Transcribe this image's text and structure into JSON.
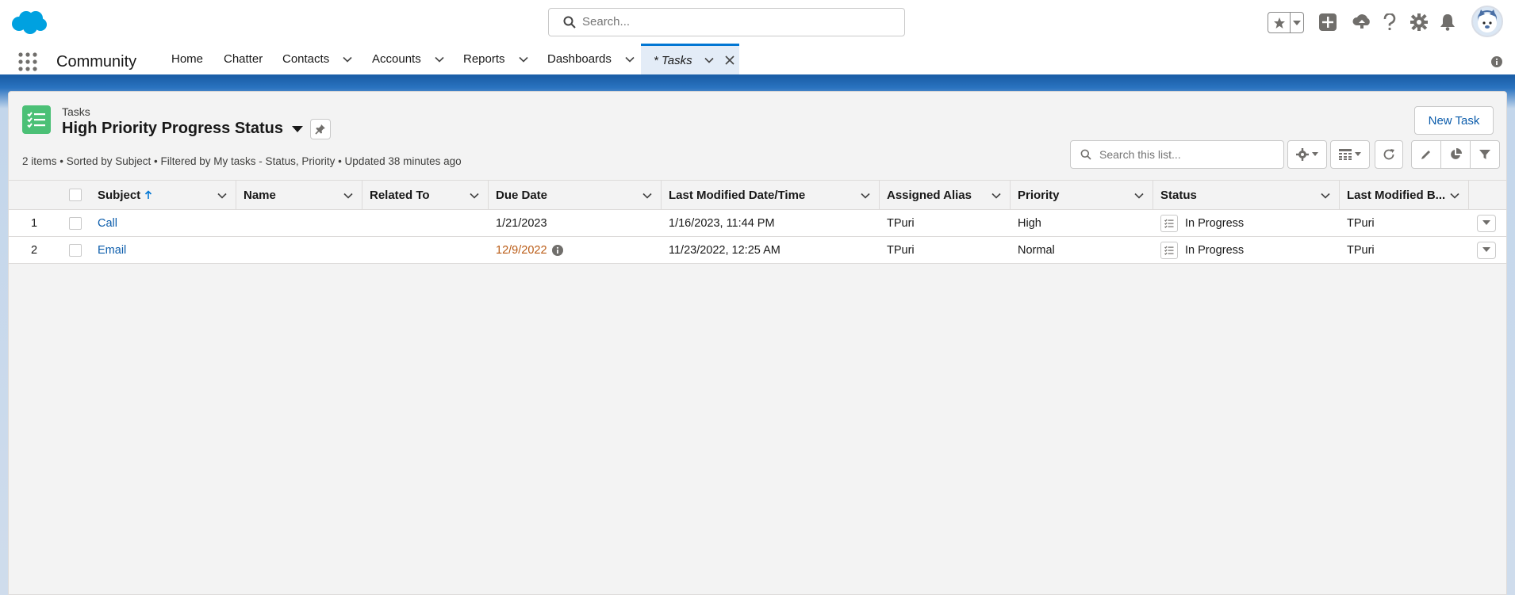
{
  "header": {
    "search_placeholder": "Search..."
  },
  "nav": {
    "app_name": "Community",
    "items": [
      {
        "label": "Home"
      },
      {
        "label": "Chatter"
      },
      {
        "label": "Contacts"
      },
      {
        "label": "Accounts"
      },
      {
        "label": "Reports"
      },
      {
        "label": "Dashboards"
      }
    ],
    "active_tab": "* Tasks"
  },
  "list_view": {
    "object_label": "Tasks",
    "title": "High Priority Progress Status",
    "meta": "2 items • Sorted by Subject • Filtered by My tasks - Status, Priority • Updated 38 minutes ago",
    "new_button": "New Task",
    "search_placeholder": "Search this list..."
  },
  "table": {
    "columns": [
      {
        "label": "Subject",
        "sort": "asc"
      },
      {
        "label": "Name"
      },
      {
        "label": "Related To"
      },
      {
        "label": "Due Date"
      },
      {
        "label": "Last Modified Date/Time"
      },
      {
        "label": "Assigned Alias"
      },
      {
        "label": "Priority"
      },
      {
        "label": "Status"
      },
      {
        "label": "Last Modified B..."
      }
    ],
    "rows": [
      {
        "num": "1",
        "subject": "Call",
        "name": "",
        "related_to": "",
        "due_date": "1/21/2023",
        "overdue": false,
        "last_modified": "1/16/2023, 11:44 PM",
        "alias": "TPuri",
        "priority": "High",
        "status": "In Progress",
        "last_modified_by": "TPuri"
      },
      {
        "num": "2",
        "subject": "Email",
        "name": "",
        "related_to": "",
        "due_date": "12/9/2022",
        "overdue": true,
        "last_modified": "11/23/2022, 12:25 AM",
        "alias": "TPuri",
        "priority": "Normal",
        "status": "In Progress",
        "last_modified_by": "TPuri"
      }
    ]
  },
  "colors": {
    "brand": "#0176d3",
    "link": "#0b5cab",
    "overdue": "#ba5b15",
    "task_icon": "#4bc076",
    "nav_band": "#1b5fa8"
  }
}
